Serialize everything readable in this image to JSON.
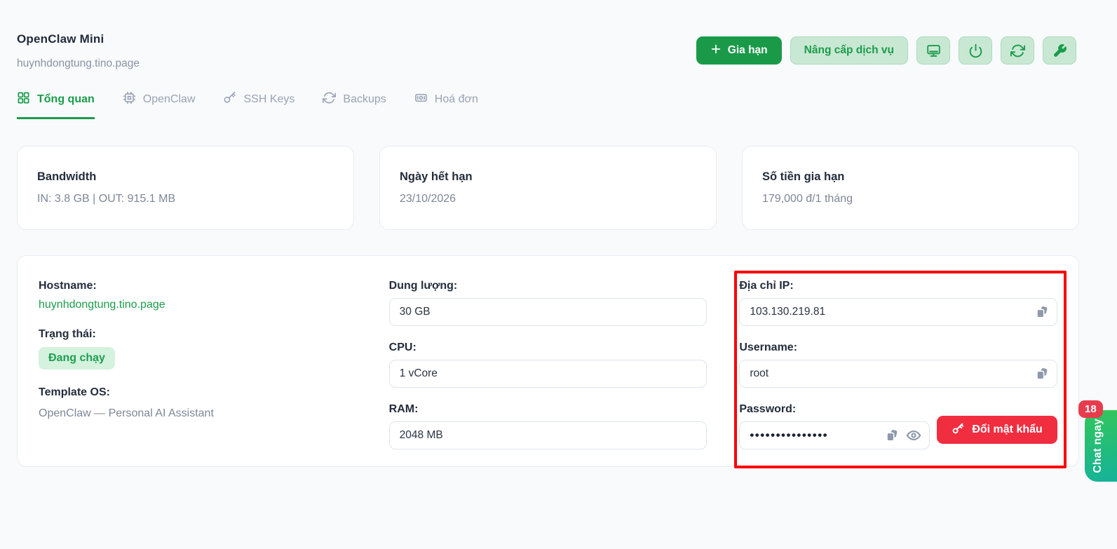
{
  "header": {
    "title": "OpenClaw Mini",
    "subtitle": "huynhdongtung.tino.page",
    "actions": {
      "renew_label": "Gia hạn",
      "upgrade_label": "Nâng cấp dịch vụ"
    }
  },
  "tabs": [
    {
      "label": "Tổng quan",
      "active": true
    },
    {
      "label": "OpenClaw",
      "active": false
    },
    {
      "label": "SSH Keys",
      "active": false
    },
    {
      "label": "Backups",
      "active": false
    },
    {
      "label": "Hoá đơn",
      "active": false
    }
  ],
  "stats": [
    {
      "title": "Bandwidth",
      "value": "IN: 3.8 GB | OUT: 915.1 MB"
    },
    {
      "title": "Ngày hết hạn",
      "value": "23/10/2026"
    },
    {
      "title": "Số tiền gia hạn",
      "value": "179,000 đ/1 tháng"
    }
  ],
  "details": {
    "hostname_label": "Hostname:",
    "hostname_value": "huynhdongtung.tino.page",
    "status_label": "Trạng thái:",
    "status_value": "Đang chạy",
    "template_label": "Template OS:",
    "template_value": "OpenClaw — Personal AI Assistant",
    "disk_label": "Dung lượng:",
    "disk_value": "30 GB",
    "cpu_label": "CPU:",
    "cpu_value": "1 vCore",
    "ram_label": "RAM:",
    "ram_value": "2048 MB",
    "ip_label": "Địa chỉ IP:",
    "ip_value": "103.130.219.81",
    "username_label": "Username:",
    "username_value": "root",
    "password_label": "Password:",
    "password_masked": "•••••••••••••••",
    "change_password_label": "Đổi mật khẩu"
  },
  "chat_widget": {
    "label": "Chat ngay",
    "badge_count": "18"
  },
  "colors": {
    "accent_green": "#1b9c4b",
    "light_green_button_bg": "#c9e8d3",
    "status_badge_bg": "#d4f2de",
    "danger_red": "#f12d40",
    "annotation_red": "#fb0007",
    "chat_badge_red": "#e73c4e",
    "page_bg": "#f8fafc"
  }
}
